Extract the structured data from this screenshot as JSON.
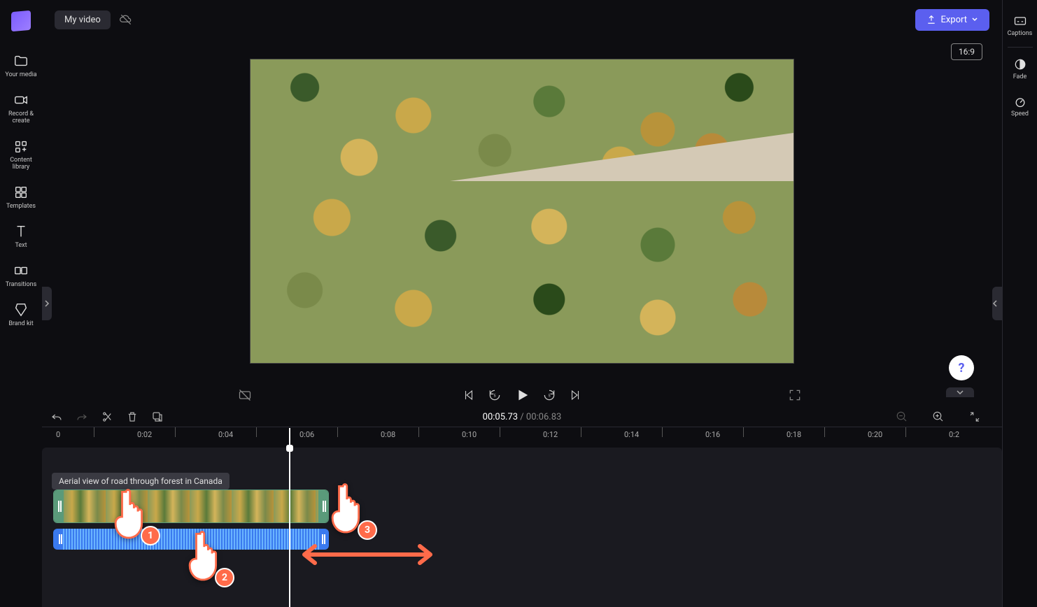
{
  "app": {
    "project_name": "My video",
    "export_label": "Export",
    "aspect_ratio": "16:9"
  },
  "left_nav": {
    "items": [
      {
        "label": "Your media",
        "icon": "folder-icon"
      },
      {
        "label": "Record & create",
        "icon": "camera-icon"
      },
      {
        "label": "Content library",
        "icon": "library-icon"
      },
      {
        "label": "Templates",
        "icon": "templates-icon"
      },
      {
        "label": "Text",
        "icon": "text-icon"
      },
      {
        "label": "Transitions",
        "icon": "transitions-icon"
      },
      {
        "label": "Brand kit",
        "icon": "brandkit-icon"
      }
    ]
  },
  "right_nav": {
    "items": [
      {
        "label": "Captions",
        "icon": "captions-icon"
      },
      {
        "label": "Fade",
        "icon": "fade-icon"
      },
      {
        "label": "Speed",
        "icon": "speed-icon"
      }
    ]
  },
  "playback": {
    "current_time": "00:05.73",
    "total_time": "00:06.83",
    "separator": " / "
  },
  "timeline": {
    "clip_name": "Aerial view of road through forest in Canada",
    "ticks": [
      "0",
      "0:02",
      "0:04",
      "0:06",
      "0:08",
      "0:10",
      "0:12",
      "0:14",
      "0:16",
      "0:18",
      "0:20",
      "0:2"
    ]
  },
  "annotation": {
    "hand1": "1",
    "hand2": "2",
    "hand3": "3"
  },
  "help": "?"
}
